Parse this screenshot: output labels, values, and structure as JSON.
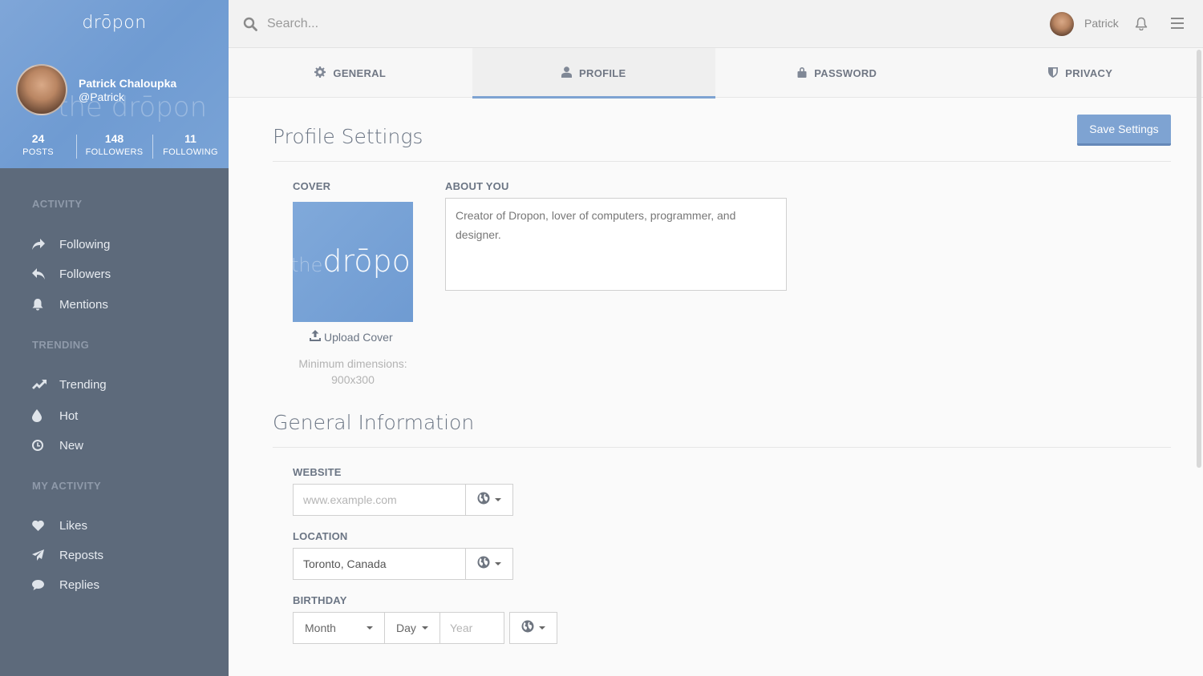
{
  "brand": {
    "logo_text": "drōpon",
    "watermark_text": "the drōpon"
  },
  "user": {
    "name": "Patrick Chaloupka",
    "handle": "@Patrick",
    "short_name": "Patrick",
    "stats": [
      {
        "value": "24",
        "label": "POSTS"
      },
      {
        "value": "148",
        "label": "FOLLOWERS"
      },
      {
        "value": "11",
        "label": "FOLLOWING"
      }
    ]
  },
  "sidebar": {
    "sections": [
      {
        "title": "ACTIVITY",
        "items": [
          {
            "label": "Following",
            "icon": "share-arrow-icon"
          },
          {
            "label": "Followers",
            "icon": "reply-arrow-icon"
          },
          {
            "label": "Mentions",
            "icon": "bell-icon"
          }
        ]
      },
      {
        "title": "TRENDING",
        "items": [
          {
            "label": "Trending",
            "icon": "trending-up-icon"
          },
          {
            "label": "Hot",
            "icon": "drop-icon"
          },
          {
            "label": "New",
            "icon": "clock-icon"
          }
        ]
      },
      {
        "title": "MY ACTIVITY",
        "items": [
          {
            "label": "Likes",
            "icon": "heart-icon"
          },
          {
            "label": "Reposts",
            "icon": "paper-plane-icon"
          },
          {
            "label": "Replies",
            "icon": "comment-icon"
          }
        ]
      }
    ]
  },
  "topbar": {
    "search_placeholder": "Search..."
  },
  "tabs": [
    {
      "label": "GENERAL",
      "icon": "gear-icon",
      "active": false
    },
    {
      "label": "PROFILE",
      "icon": "user-icon",
      "active": true
    },
    {
      "label": "PASSWORD",
      "icon": "lock-icon",
      "active": false
    },
    {
      "label": "PRIVACY",
      "icon": "shield-icon",
      "active": false
    }
  ],
  "profile": {
    "title": "Profile Settings",
    "save_label": "Save Settings",
    "cover_label": "COVER",
    "cover_logo_prefix": "the",
    "cover_logo_text": "drōpon",
    "upload_label": "Upload Cover",
    "min_dims_line1": "Minimum dimensions:",
    "min_dims_line2": "900x300",
    "about_label": "ABOUT YOU",
    "about_value": "Creator of Dropon, lover of computers, programmer, and designer."
  },
  "general": {
    "title": "General Information",
    "website_label": "WEBSITE",
    "website_placeholder": "www.example.com",
    "location_label": "LOCATION",
    "location_value": "Toronto, Canada",
    "birthday_label": "BIRTHDAY",
    "month_value": "Month",
    "day_value": "Day",
    "year_placeholder": "Year"
  },
  "colors": {
    "accent": "#7ea3d2",
    "sidebar_bg": "#5d6a7b"
  }
}
